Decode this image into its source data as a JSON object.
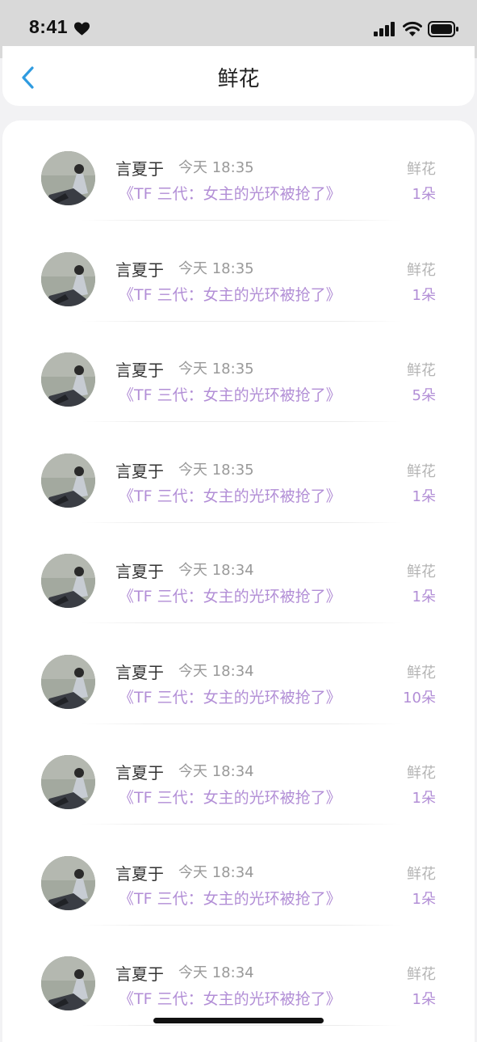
{
  "status_bar": {
    "time": "8:41"
  },
  "header": {
    "title": "鲜花"
  },
  "colors": {
    "accent": "#b28ed6",
    "back_arrow": "#2f9be0",
    "muted": "#999999"
  },
  "rows": [
    {
      "username": "言夏于",
      "time": "今天 18:35",
      "book": "《TF 三代：女主的光环被抢了》",
      "gift": "鲜花",
      "count": "1朵"
    },
    {
      "username": "言夏于",
      "time": "今天 18:35",
      "book": "《TF 三代：女主的光环被抢了》",
      "gift": "鲜花",
      "count": "1朵"
    },
    {
      "username": "言夏于",
      "time": "今天 18:35",
      "book": "《TF 三代：女主的光环被抢了》",
      "gift": "鲜花",
      "count": "5朵"
    },
    {
      "username": "言夏于",
      "time": "今天 18:35",
      "book": "《TF 三代：女主的光环被抢了》",
      "gift": "鲜花",
      "count": "1朵"
    },
    {
      "username": "言夏于",
      "time": "今天 18:34",
      "book": "《TF 三代：女主的光环被抢了》",
      "gift": "鲜花",
      "count": "1朵"
    },
    {
      "username": "言夏于",
      "time": "今天 18:34",
      "book": "《TF 三代：女主的光环被抢了》",
      "gift": "鲜花",
      "count": "10朵"
    },
    {
      "username": "言夏于",
      "time": "今天 18:34",
      "book": "《TF 三代：女主的光环被抢了》",
      "gift": "鲜花",
      "count": "1朵"
    },
    {
      "username": "言夏于",
      "time": "今天 18:34",
      "book": "《TF 三代：女主的光环被抢了》",
      "gift": "鲜花",
      "count": "1朵"
    },
    {
      "username": "言夏于",
      "time": "今天 18:34",
      "book": "《TF 三代：女主的光环被抢了》",
      "gift": "鲜花",
      "count": "1朵"
    }
  ]
}
